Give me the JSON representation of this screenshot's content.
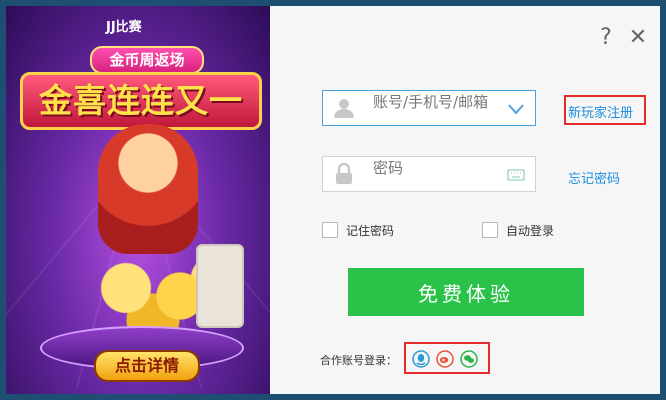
{
  "promo": {
    "brand": "JJ比赛",
    "subtitle": "金币周返场",
    "headline": "金喜连连又一波",
    "cta": "点击详情"
  },
  "window": {
    "help_symbol": "?",
    "close_symbol": "✕"
  },
  "login": {
    "account_placeholder": "账号/手机号/邮箱",
    "password_placeholder": "密码",
    "register_link": "新玩家注册",
    "forgot_link": "忘记密码",
    "remember_label": "记住密码",
    "autologin_label": "自动登录",
    "submit_label": "免费体验",
    "partner_label": "合作账号登录："
  },
  "social": [
    {
      "name": "qq-icon",
      "color": "#2a9bd8"
    },
    {
      "name": "weibo-icon",
      "color": "#e8533a"
    },
    {
      "name": "wechat-icon",
      "color": "#2bb34a"
    }
  ],
  "colors": {
    "accent": "#1d8ee0",
    "submit": "#2bc24a",
    "highlight_box": "#e52b2b",
    "frame": "#1e4f73"
  }
}
